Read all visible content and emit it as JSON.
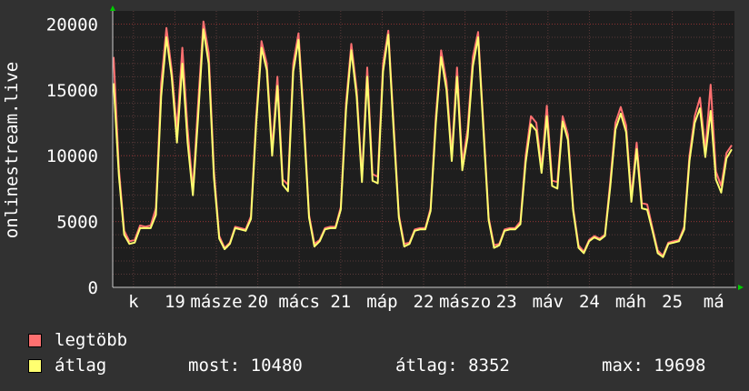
{
  "chart_data": {
    "type": "line",
    "ylabel": "onlinestream.live",
    "ylim": [
      0,
      21000
    ],
    "y_ticks": [
      0,
      5000,
      10000,
      15000,
      20000
    ],
    "y_tick_labels": [
      "0",
      "5000",
      "10000",
      "15000",
      "20000"
    ],
    "x_tick_labels": [
      "k",
      "19",
      "másze",
      "20",
      "mács",
      "21",
      "máp",
      "22",
      "mászo",
      "23",
      "máv",
      "24",
      "máh",
      "25",
      "má"
    ],
    "grid": true,
    "series": [
      {
        "name": "legtöbb",
        "color": "#ff7070",
        "values": [
          17500,
          9000,
          4300,
          3500,
          3600,
          4700,
          4600,
          4700,
          6000,
          15500,
          19700,
          16500,
          12000,
          18200,
          12000,
          7400,
          14000,
          20200,
          17800,
          8800,
          3900,
          3000,
          3400,
          4600,
          4500,
          4400,
          5400,
          13000,
          18700,
          17000,
          10500,
          16000,
          8200,
          7800,
          17000,
          19300,
          13000,
          5500,
          3300,
          3600,
          4500,
          4600,
          4600,
          6100,
          14000,
          18500,
          15000,
          8400,
          16700,
          8600,
          8400,
          17000,
          19500,
          12500,
          5500,
          3300,
          3400,
          4400,
          4500,
          4500,
          6000,
          13000,
          18000,
          15600,
          10100,
          16700,
          9400,
          12000,
          17500,
          19400,
          12400,
          5300,
          3200,
          3300,
          4400,
          4500,
          4500,
          5000,
          10000,
          13000,
          12500,
          9100,
          13800,
          8100,
          8000,
          13000,
          11600,
          6000,
          3200,
          2700,
          3600,
          3900,
          3700,
          4000,
          8000,
          12500,
          13700,
          12300,
          6900,
          11000,
          6400,
          6300,
          4500,
          2800,
          2400,
          3400,
          3500,
          3600,
          4600,
          10000,
          13000,
          14400,
          10400,
          15400,
          8800,
          7700,
          10200,
          10800
        ]
      },
      {
        "name": "átlag",
        "color": "#ffff70",
        "values": [
          15500,
          8500,
          4000,
          3300,
          3400,
          4500,
          4500,
          4500,
          5500,
          14500,
          19000,
          16000,
          11000,
          17000,
          11000,
          7000,
          13000,
          19600,
          17000,
          8300,
          3700,
          2900,
          3300,
          4500,
          4400,
          4300,
          5200,
          12500,
          18200,
          16500,
          10000,
          15300,
          7800,
          7300,
          16400,
          18800,
          12500,
          5300,
          3100,
          3500,
          4400,
          4500,
          4500,
          5900,
          13500,
          18000,
          14500,
          8000,
          16000,
          8100,
          7900,
          16400,
          19200,
          12000,
          5300,
          3100,
          3300,
          4300,
          4400,
          4400,
          5800,
          12500,
          17500,
          15000,
          9600,
          16000,
          8900,
          11400,
          16800,
          19000,
          12000,
          5100,
          3000,
          3200,
          4300,
          4400,
          4400,
          4800,
          9500,
          12400,
          11900,
          8700,
          13000,
          7700,
          7500,
          12600,
          11200,
          5800,
          3000,
          2600,
          3500,
          3800,
          3600,
          3900,
          7600,
          12000,
          13200,
          11800,
          6500,
          10500,
          6000,
          5900,
          4300,
          2600,
          2300,
          3300,
          3400,
          3500,
          4400,
          9600,
          12500,
          13600,
          9900,
          13400,
          8200,
          7200,
          9800,
          10480
        ]
      }
    ]
  },
  "legend": [
    {
      "label": "legtöbb",
      "color": "#ff7070"
    },
    {
      "label": "átlag",
      "color": "#ffff70"
    }
  ],
  "stats": {
    "most": "most: 10480",
    "atlag": "átlag: 8352",
    "max": "max: 19698"
  },
  "colors": {
    "background": "#313131",
    "plot_background": "#1e1e1e",
    "axis_arrow": "#00cc00"
  }
}
